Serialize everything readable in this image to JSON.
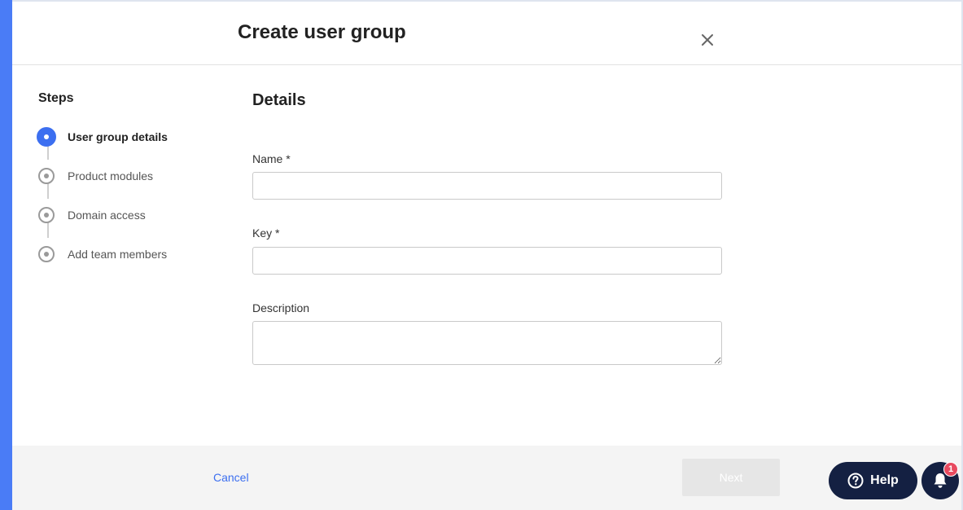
{
  "modal": {
    "title": "Create user group"
  },
  "steps": {
    "title": "Steps",
    "items": [
      {
        "label": "User group details",
        "active": true
      },
      {
        "label": "Product modules",
        "active": false
      },
      {
        "label": "Domain access",
        "active": false
      },
      {
        "label": "Add team members",
        "active": false
      }
    ]
  },
  "form": {
    "section_title": "Details",
    "name_label": "Name *",
    "name_value": "",
    "key_label": "Key *",
    "key_value": "",
    "description_label": "Description",
    "description_value": ""
  },
  "footer": {
    "cancel_label": "Cancel",
    "next_label": "Next"
  },
  "widgets": {
    "help_label": "Help",
    "notification_count": "1"
  },
  "colors": {
    "accent": "#3c6ff0",
    "sidebar_accent": "#4a7cf6",
    "widget_bg": "#142042",
    "badge": "#e84a5f"
  },
  "icons": {
    "close": "close-icon",
    "help": "question-circle-icon",
    "bell": "bell-icon"
  }
}
